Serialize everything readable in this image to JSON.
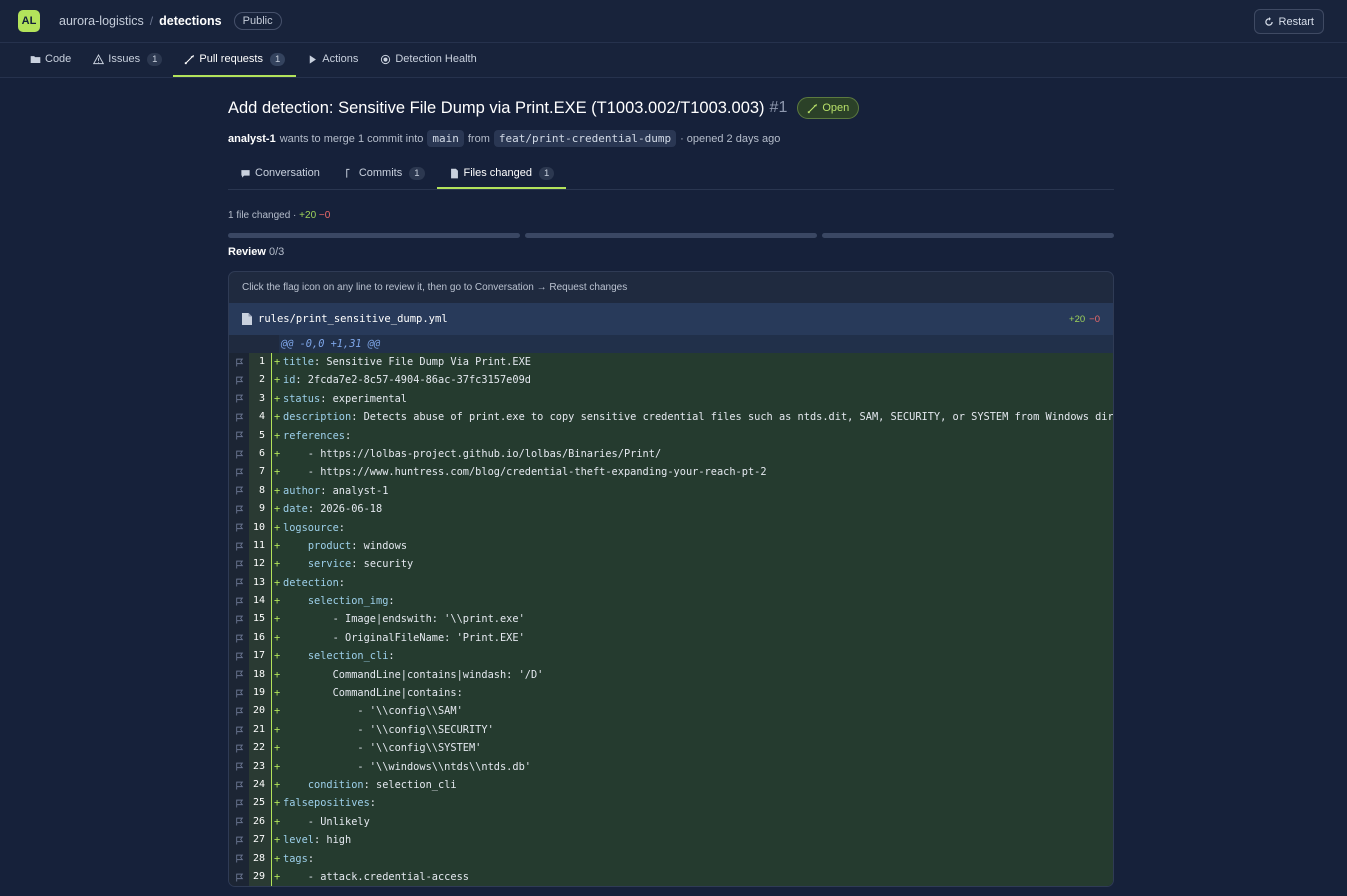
{
  "header": {
    "avatar": "AL",
    "owner": "aurora-logistics",
    "separator": "/",
    "repo": "detections",
    "visibility": "Public",
    "restart_label": "Restart"
  },
  "repo_nav": [
    {
      "label": "Code",
      "icon": "folder-icon",
      "count": ""
    },
    {
      "label": "Issues",
      "icon": "warning-icon",
      "count": "1"
    },
    {
      "label": "Pull requests",
      "icon": "pull-request-icon",
      "count": "1",
      "active": true
    },
    {
      "label": "Actions",
      "icon": "play-icon",
      "count": ""
    },
    {
      "label": "Detection Health",
      "icon": "radio-icon",
      "count": ""
    }
  ],
  "pr": {
    "title": "Add detection: Sensitive File Dump via Print.EXE (T1003.002/T1003.003)",
    "number": "#1",
    "status": "Open",
    "author": "analyst-1",
    "meta_text_1": "wants to merge 1 commit into",
    "base_branch": "main",
    "meta_text_2": "from",
    "head_branch": "feat/print-credential-dump",
    "meta_text_3": "· opened 2 days ago"
  },
  "pr_tabs": [
    {
      "label": "Conversation",
      "icon": "comment-icon",
      "count": ""
    },
    {
      "label": "Commits",
      "icon": "commit-icon",
      "count": "1"
    },
    {
      "label": "Files changed",
      "icon": "file-icon",
      "count": "1",
      "active": true
    }
  ],
  "files_summary": {
    "text": "1 file changed ·",
    "additions": "+20",
    "deletions": "−0"
  },
  "review": {
    "label": "Review",
    "progress": "0/3",
    "segments_total": 3,
    "segments_done": 0
  },
  "panel": {
    "hint": "Click the flag icon on any line to review it, then go to Conversation → Request changes",
    "file_name": "rules/print_sensitive_dump.yml",
    "additions": "+20",
    "deletions": "−0",
    "hunk": "@@ -0,0 +1,31 @@"
  },
  "diff_lines": [
    {
      "n": "1",
      "key": "title",
      "rest": ": Sensitive File Dump Via Print.EXE"
    },
    {
      "n": "2",
      "key": "id",
      "rest": ": 2fcda7e2-8c57-4904-86ac-37fc3157e09d"
    },
    {
      "n": "3",
      "key": "status",
      "rest": ": experimental"
    },
    {
      "n": "4",
      "key": "description",
      "rest": ": Detects abuse of print.exe to copy sensitive credential files such as ntds.dit, SAM, SECURITY, or SYSTEM from Windows directo"
    },
    {
      "n": "5",
      "key": "references",
      "rest": ":"
    },
    {
      "n": "6",
      "key": "",
      "rest": "    - https://lolbas-project.github.io/lolbas/Binaries/Print/"
    },
    {
      "n": "7",
      "key": "",
      "rest": "    - https://www.huntress.com/blog/credential-theft-expanding-your-reach-pt-2"
    },
    {
      "n": "8",
      "key": "author",
      "rest": ": analyst-1"
    },
    {
      "n": "9",
      "key": "date",
      "rest": ": 2026-06-18"
    },
    {
      "n": "10",
      "key": "logsource",
      "rest": ":"
    },
    {
      "n": "11",
      "indent": "    ",
      "key": "product",
      "rest": ": windows"
    },
    {
      "n": "12",
      "indent": "    ",
      "key": "service",
      "rest": ": security"
    },
    {
      "n": "13",
      "key": "detection",
      "rest": ":"
    },
    {
      "n": "14",
      "indent": "    ",
      "key": "selection_img",
      "rest": ":"
    },
    {
      "n": "15",
      "key": "",
      "rest": "        - Image|endswith: '\\\\print.exe'"
    },
    {
      "n": "16",
      "key": "",
      "rest": "        - OriginalFileName: 'Print.EXE'"
    },
    {
      "n": "17",
      "indent": "    ",
      "key": "selection_cli",
      "rest": ":"
    },
    {
      "n": "18",
      "key": "",
      "rest": "        CommandLine|contains|windash: '/D'"
    },
    {
      "n": "19",
      "key": "",
      "rest": "        CommandLine|contains:"
    },
    {
      "n": "20",
      "key": "",
      "rest": "            - '\\\\config\\\\SAM'"
    },
    {
      "n": "21",
      "key": "",
      "rest": "            - '\\\\config\\\\SECURITY'"
    },
    {
      "n": "22",
      "key": "",
      "rest": "            - '\\\\config\\\\SYSTEM'"
    },
    {
      "n": "23",
      "key": "",
      "rest": "            - '\\\\windows\\\\ntds\\\\ntds.db'"
    },
    {
      "n": "24",
      "indent": "    ",
      "key": "condition",
      "rest": ": selection_cli"
    },
    {
      "n": "25",
      "key": "falsepositives",
      "rest": ":"
    },
    {
      "n": "26",
      "key": "",
      "rest": "    - Unlikely"
    },
    {
      "n": "27",
      "key": "level",
      "rest": ": high"
    },
    {
      "n": "28",
      "key": "tags",
      "rest": ":"
    },
    {
      "n": "29",
      "key": "",
      "rest": "    - attack.credential-access"
    }
  ]
}
